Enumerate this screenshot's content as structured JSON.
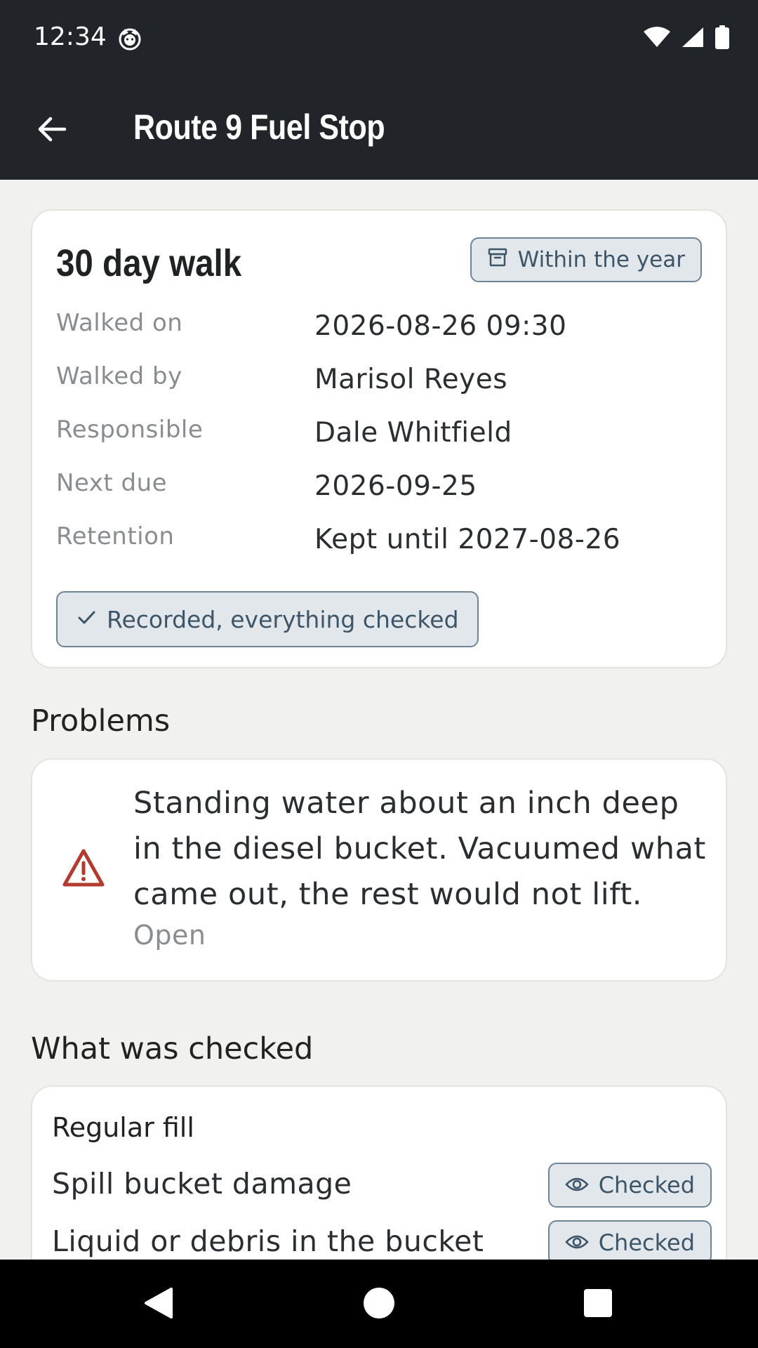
{
  "status_bar": {
    "time": "12:34",
    "icons": [
      "cat-notification-icon",
      "wifi-icon",
      "signal-icon",
      "battery-icon"
    ]
  },
  "app_bar": {
    "title": "Route 9 Fuel Stop",
    "back_icon": "arrow-back-icon"
  },
  "summary": {
    "title": "30 day walk",
    "retention_chip": {
      "icon": "archive-icon",
      "label": "Within the year"
    },
    "details": [
      {
        "label": "Walked on",
        "value": "2026-08-26 09:30"
      },
      {
        "label": "Walked by",
        "value": "Marisol Reyes"
      },
      {
        "label": "Responsible",
        "value": "Dale Whitfield"
      },
      {
        "label": "Next due",
        "value": "2026-09-25"
      },
      {
        "label": "Retention",
        "value": "Kept until 2027-08-26"
      }
    ],
    "status_chip": {
      "icon": "check-icon",
      "label": "Recorded, everything checked"
    }
  },
  "problems": {
    "heading": "Problems",
    "items": [
      {
        "icon": "warning-icon",
        "text": "Standing water about an inch deep in the diesel bucket. Vacuumed what came out, the rest would not lift.",
        "status": "Open"
      }
    ]
  },
  "checked": {
    "heading": "What was checked",
    "groups": [
      {
        "title": "Regular fill",
        "items": [
          {
            "label": "Spill bucket damage",
            "chip_icon": "eye-icon",
            "chip_label": "Checked"
          },
          {
            "label": "Liquid or debris in the bucket",
            "chip_icon": "eye-icon",
            "chip_label": "Checked"
          }
        ]
      }
    ]
  },
  "colors": {
    "app_bar": "#212529",
    "background": "#f1f1ef",
    "chip_bg": "#e2e7ec",
    "chip_border": "#6f8496",
    "chip_text": "#3e5568",
    "warning": "#b23a2e"
  }
}
